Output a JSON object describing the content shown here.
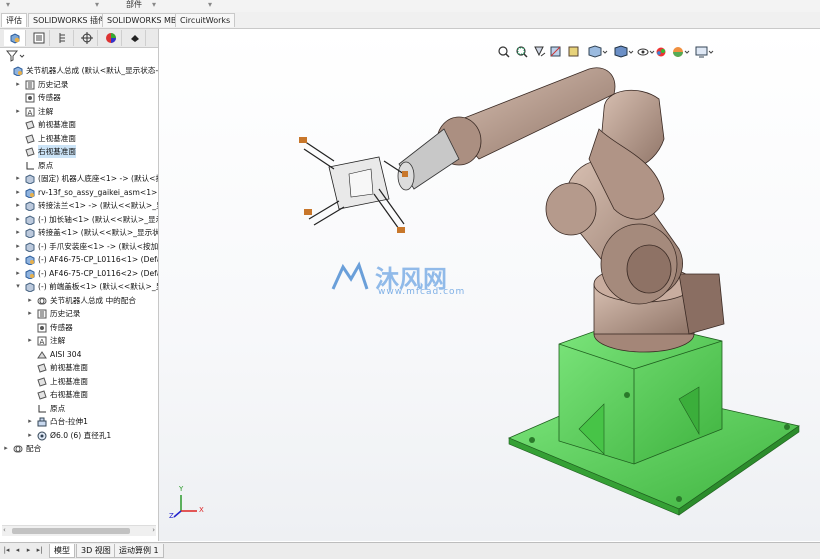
{
  "top_strip": {
    "label_1": "部件"
  },
  "tabs": [
    "评估",
    "SOLIDWORKS 插件",
    "SOLIDWORKS MBD",
    "CircuitWorks"
  ],
  "manager_tabs": [
    "featuremanager-icon",
    "propertymanager-icon",
    "configurationmanager-icon",
    "dimxpert-icon",
    "displaymanager-icon",
    "cam-icon"
  ],
  "tree": [
    {
      "label": "关节机器人总成 (默认<默认_显示状态-1",
      "indent": 0,
      "arrow": "",
      "icon": "assembly"
    },
    {
      "label": "历史记录",
      "indent": 1,
      "arrow": "▸",
      "icon": "history"
    },
    {
      "label": "传感器",
      "indent": 1,
      "arrow": "",
      "icon": "sensor"
    },
    {
      "label": "注解",
      "indent": 1,
      "arrow": "▸",
      "icon": "annotation"
    },
    {
      "label": "前视基准面",
      "indent": 1,
      "arrow": "",
      "icon": "plane"
    },
    {
      "label": "上视基准面",
      "indent": 1,
      "arrow": "",
      "icon": "plane"
    },
    {
      "label": "右视基准面",
      "indent": 1,
      "arrow": "",
      "icon": "plane",
      "selected": true
    },
    {
      "label": "原点",
      "indent": 1,
      "arrow": "",
      "icon": "origin"
    },
    {
      "label": "(固定) 机器人底座<1> -> (默认<按",
      "indent": 1,
      "arrow": "▸",
      "icon": "part"
    },
    {
      "label": "rv-13f_so_assy_gaikei_asm<1> (默",
      "indent": 1,
      "arrow": "▸",
      "icon": "assembly"
    },
    {
      "label": "转接法兰<1> -> (默认<<默认>_显示",
      "indent": 1,
      "arrow": "▸",
      "icon": "part"
    },
    {
      "label": "(-) 加长轴<1> (默认<<默认>_显示",
      "indent": 1,
      "arrow": "▸",
      "icon": "part"
    },
    {
      "label": "转接盖<1> (默认<<默认>_显示状态",
      "indent": 1,
      "arrow": "▸",
      "icon": "part"
    },
    {
      "label": "(-) 手爪安装座<1> -> (默认<按加工",
      "indent": 1,
      "arrow": "▸",
      "icon": "part"
    },
    {
      "label": "(-) AF46-75-CP_L0116<1> (Default",
      "indent": 1,
      "arrow": "▸",
      "icon": "assembly"
    },
    {
      "label": "(-) AF46-75-CP_L0116<2> (Default",
      "indent": 1,
      "arrow": "▸",
      "icon": "assembly"
    },
    {
      "label": "(-) 前端盖板<1> (默认<<默认>_显示",
      "indent": 1,
      "arrow": "▾",
      "icon": "part"
    },
    {
      "label": "关节机器人总成 中的配合",
      "indent": 2,
      "arrow": "▸",
      "icon": "mates"
    },
    {
      "label": "历史记录",
      "indent": 2,
      "arrow": "▸",
      "icon": "history"
    },
    {
      "label": "传感器",
      "indent": 2,
      "arrow": "",
      "icon": "sensor"
    },
    {
      "label": "注解",
      "indent": 2,
      "arrow": "▸",
      "icon": "annotation"
    },
    {
      "label": "AISI 304",
      "indent": 2,
      "arrow": "",
      "icon": "material"
    },
    {
      "label": "前视基准面",
      "indent": 2,
      "arrow": "",
      "icon": "plane"
    },
    {
      "label": "上视基准面",
      "indent": 2,
      "arrow": "",
      "icon": "plane"
    },
    {
      "label": "右视基准面",
      "indent": 2,
      "arrow": "",
      "icon": "plane"
    },
    {
      "label": "原点",
      "indent": 2,
      "arrow": "",
      "icon": "origin"
    },
    {
      "label": "凸台-拉伸1",
      "indent": 2,
      "arrow": "▸",
      "icon": "feature"
    },
    {
      "label": "Ø6.0 (6) 直径孔1",
      "indent": 2,
      "arrow": "▸",
      "icon": "hole"
    },
    {
      "label": "配合",
      "indent": 0,
      "arrow": "▸",
      "icon": "mates"
    }
  ],
  "bottom_tabs": [
    "模型",
    "3D 视图",
    "运动算例 1"
  ],
  "watermark": {
    "brand": "沐风网",
    "url": "www.mfcad.com"
  },
  "triad": {
    "x": "X",
    "y": "Y",
    "z": "Z"
  },
  "colors": {
    "robot": "#b4988a",
    "base": "#5fd35f",
    "selection": "#cce4f7"
  }
}
